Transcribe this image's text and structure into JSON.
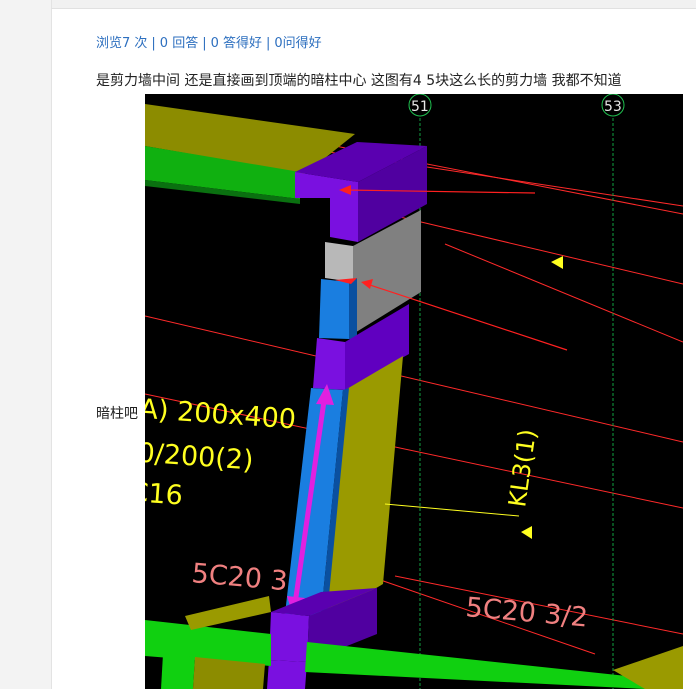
{
  "stats": {
    "views": "浏览7 次",
    "answers": "0 回答",
    "good_answers": "0 答得好",
    "good_questions": "0问得好",
    "separator": "|"
  },
  "question": {
    "text": "是剪力墙中间 还是直接画到顶端的暗柱中心  这图有4 5块这么长的剪力墙 我都不知道"
  },
  "answer": {
    "text": "暗柱吧"
  },
  "figure": {
    "axis_labels": [
      "51",
      "53"
    ],
    "beam_text_1": "A) 200x400",
    "beam_text_2": "0/200(2)",
    "beam_text_3": "C16",
    "beam_name": "KL3(1)",
    "rebar_1": "5C20 3",
    "rebar_2": "5C20 3/2",
    "colors": {
      "background": "#000000",
      "wall_purple": "#6a00c8",
      "wall_grey": "#808080",
      "column_blue": "#1a7ee0",
      "beam_olive": "#9a9a00",
      "beam_green": "#10c010",
      "arrow_magenta": "#e020e0",
      "grid_red": "#ff2020",
      "label_yellow": "#ffff20",
      "label_pink": "#f08080"
    }
  }
}
